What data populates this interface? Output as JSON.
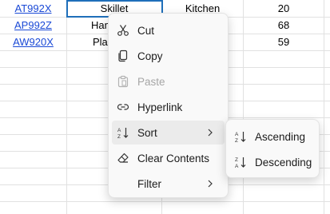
{
  "rows": [
    {
      "code": "AT992X",
      "name": "Skillet",
      "category": "Kitchen",
      "qty": "20"
    },
    {
      "code": "AP992Z",
      "name": "Hamilto",
      "category": "",
      "qty": "68"
    },
    {
      "code": "AW920X",
      "name": "Pla",
      "category": "",
      "qty": "59"
    }
  ],
  "context_menu": {
    "items": [
      {
        "label": "Cut",
        "icon": "scissors-icon",
        "disabled": false
      },
      {
        "label": "Copy",
        "icon": "copy-icon",
        "disabled": false
      },
      {
        "label": "Paste",
        "icon": "paste-icon",
        "disabled": true
      },
      {
        "label": "Hyperlink",
        "icon": "link-icon",
        "disabled": false
      },
      {
        "label": "Sort",
        "icon": "sort-icon",
        "disabled": false,
        "submenu": true,
        "highlighted": true
      },
      {
        "label": "Clear Contents",
        "icon": "eraser-icon",
        "disabled": false
      },
      {
        "label": "Filter",
        "icon": "",
        "disabled": false,
        "submenu": true
      }
    ]
  },
  "sort_submenu": {
    "items": [
      {
        "label": "Ascending",
        "icon": "sort-ascending-icon"
      },
      {
        "label": "Descending",
        "icon": "sort-descending-icon"
      }
    ]
  },
  "colors": {
    "link": "#1a49d6",
    "selection_border": "#1f6fba",
    "menu_background": "#f9f9f9",
    "menu_highlight": "#ebebeb",
    "gridline": "#e1e1e1"
  }
}
